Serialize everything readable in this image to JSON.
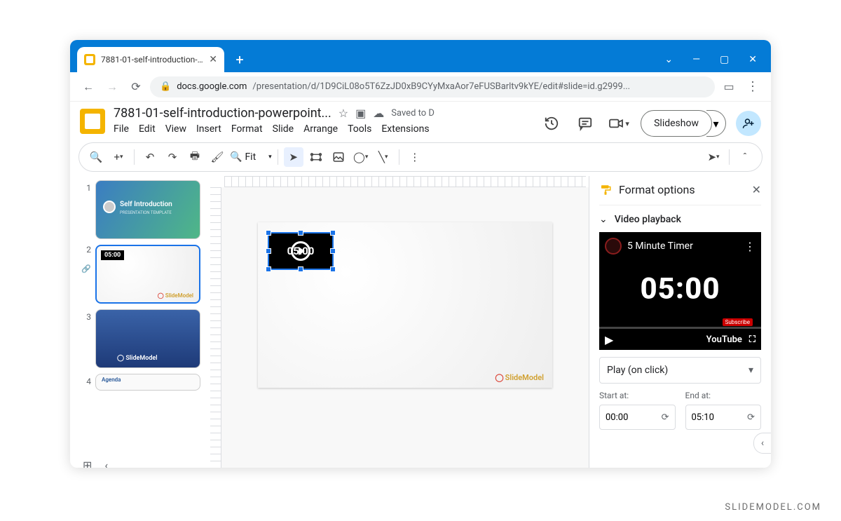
{
  "browser": {
    "tab_title": "7881-01-self-introduction-powe",
    "url_host": "docs.google.com",
    "url_path": "/presentation/d/1D9CiL08o5T6ZzJD0xB9CYyMxaAor7eFUSBarltv9kYE/edit#slide=id.g2999..."
  },
  "header": {
    "doc_title": "7881-01-self-introduction-powerpoint...",
    "saved_status": "Saved to D",
    "slideshow_label": "Slideshow"
  },
  "menus": [
    "File",
    "Edit",
    "View",
    "Insert",
    "Format",
    "Slide",
    "Arrange",
    "Tools",
    "Extensions"
  ],
  "toolbar": {
    "zoom_label": "Fit"
  },
  "slides": [
    {
      "num": "1",
      "caption": "Self Introduction"
    },
    {
      "num": "2",
      "caption": "05:00"
    },
    {
      "num": "3",
      "caption": "SlideModel"
    },
    {
      "num": "4",
      "caption": "Agenda"
    }
  ],
  "canvas": {
    "video_label": "05:00",
    "slidemodel_label": "SlideModel"
  },
  "panel": {
    "title": "Format options",
    "section": "Video playback",
    "video_title": "5 Minute Timer",
    "timer_text": "05:00",
    "subscribe": "Subscribe",
    "youtube": "YouTube",
    "play_mode": "Play (on click)",
    "start_label": "Start at:",
    "end_label": "End at:",
    "start_value": "00:00",
    "end_value": "05:10"
  },
  "watermark": "SLIDEMODEL.COM"
}
